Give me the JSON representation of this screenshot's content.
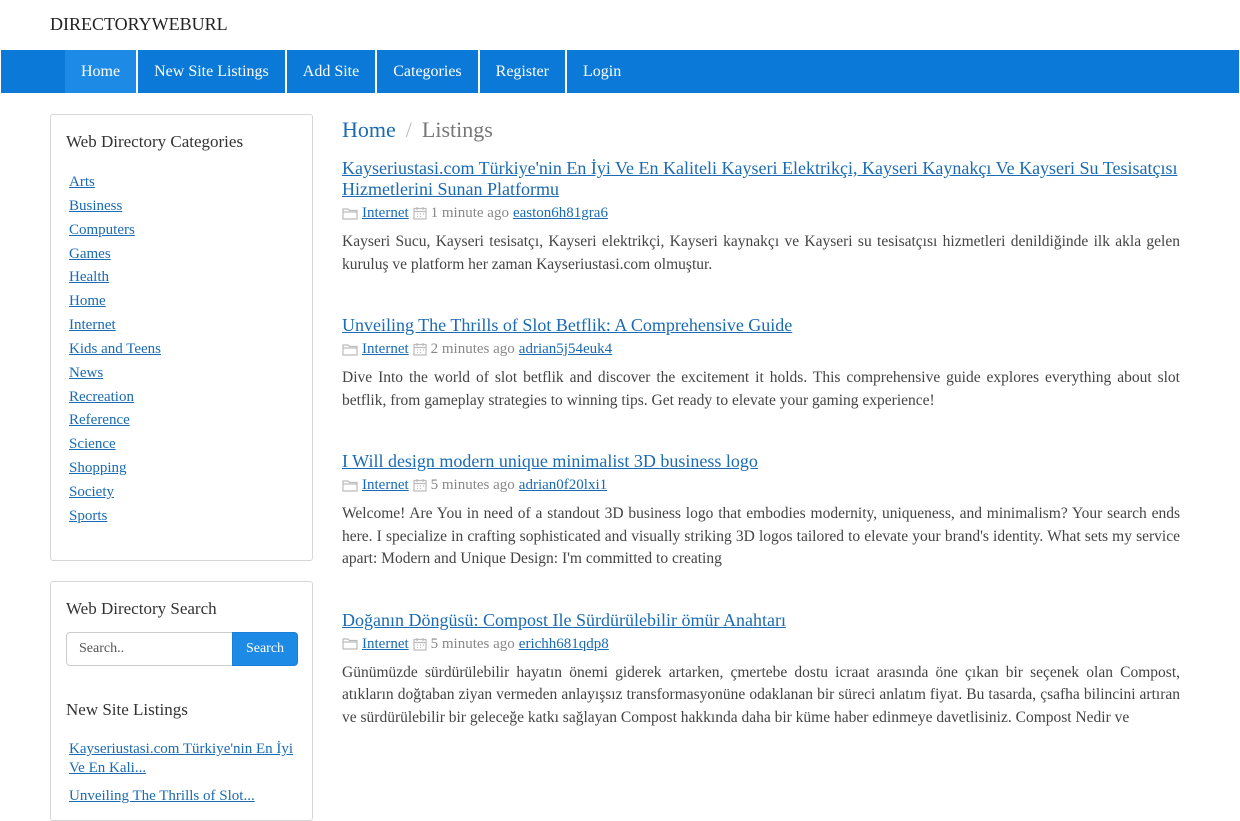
{
  "brand": "DIRECTORYWEBURL",
  "nav": {
    "items": [
      "Home",
      "New Site Listings",
      "Add Site",
      "Categories",
      "Register",
      "Login"
    ]
  },
  "sidebar": {
    "categories_title": "Web Directory Categories",
    "categories": [
      "Arts",
      "Business",
      "Computers",
      "Games",
      "Health",
      "Home",
      "Internet",
      "Kids and Teens",
      "News",
      "Recreation",
      "Reference",
      "Science",
      "Shopping",
      "Society",
      "Sports"
    ],
    "search_title": "Web Directory Search",
    "search_placeholder": "Search..",
    "search_button": "Search",
    "new_listings_title": "New Site Listings",
    "new_listings": [
      "Kayseriustasi.com Türkiye'nin En İyi Ve En Kali...",
      "Unveiling The Thrills of Slot..."
    ]
  },
  "breadcrumb": {
    "home": "Home",
    "separator": "/",
    "current": "Listings"
  },
  "listings": [
    {
      "title": "Kayseriustasi.com Türkiye'nin En İyi Ve En Kaliteli Kayseri Elektrikçi, Kayseri Kaynakçı Ve Kayseri Su Tesisatçısı Hizmetlerini Sunan Platformu",
      "category": "Internet",
      "time": "1 minute ago",
      "user": "easton6h81gra6",
      "description": "Kayseri Sucu, Kayseri tesisatçı, Kayseri elektrikçi, Kayseri kaynakçı ve Kayseri su tesisatçısı hizmetleri denildiğinde ilk akla gelen kuruluş ve platform her zaman Kayseriustasi.com olmuştur."
    },
    {
      "title": "Unveiling The Thrills of Slot Betflik: A Comprehensive Guide",
      "category": "Internet",
      "time": "2 minutes ago",
      "user": "adrian5j54euk4",
      "description": "Dive Into the world of slot betflik and discover the excitement it holds. This comprehensive guide explores everything about slot betflik, from gameplay strategies to winning tips. Get ready to elevate your gaming experience!"
    },
    {
      "title": "I Will design modern unique minimalist 3D business logo",
      "category": "Internet",
      "time": "5 minutes ago",
      "user": "adrian0f20lxi1",
      "description": "Welcome! Are You in need of a standout 3D business logo that embodies modernity, uniqueness, and minimalism? Your search ends here. I specialize in crafting sophisticated and visually striking 3D logos tailored to elevate your brand's identity. What sets my service apart: Modern and Unique Design: I'm committed to creating"
    },
    {
      "title": "Doğanın Döngüsü: Compost Ile Sürdürülebilir ömür Anahtarı",
      "category": "Internet",
      "time": "5 minutes ago",
      "user": "erichh681qdp8",
      "description": "Günümüzde sürdürülebilir hayatın önemi giderek artarken, çmertebe dostu icraat arasında öne çıkan bir seçenek olan Compost, atıkların doğtaban ziyan vermeden anlayışsız transformasyonüne odaklanan bir süreci anlatım fiyat. Bu tasarda, çsafha bilincini artıran ve sürdürülebilir bir geleceğe katkı sağlayan Compost hakkında daha bir küme haber edinmeye davetlisiniz. Compost Nedir ve"
    }
  ],
  "colors": {
    "nav_bg": "#0b79d8",
    "nav_active": "#1d8ae6",
    "link": "#1a6bb3"
  }
}
